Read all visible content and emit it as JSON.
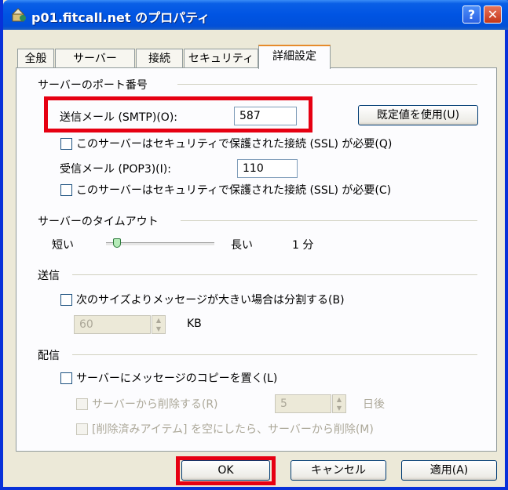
{
  "window": {
    "title": "p01.fitcall.net のプロパティ",
    "help_label": "?",
    "close_label": "✕"
  },
  "tabs": [
    {
      "label": "全般"
    },
    {
      "label": "サーバー"
    },
    {
      "label": "接続"
    },
    {
      "label": "セキュリティ"
    },
    {
      "label": "詳細設定"
    }
  ],
  "ports": {
    "section_title": "サーバーのポート番号",
    "smtp_label": "送信メール (SMTP)(O):",
    "smtp_value": "587",
    "default_button": "既定値を使用(U)",
    "smtp_ssl_label": "このサーバーはセキュリティで保護された接続 (SSL) が必要(Q)",
    "pop3_label": "受信メール (POP3)(I):",
    "pop3_value": "110",
    "pop3_ssl_label": "このサーバーはセキュリティで保護された接続 (SSL) が必要(C)"
  },
  "timeout": {
    "section_title": "サーバーのタイムアウト",
    "short_label": "短い",
    "long_label": "長い",
    "value_label": "1 分",
    "slider_level": 0.1
  },
  "sending": {
    "section_title": "送信",
    "split_label": "次のサイズよりメッセージが大きい場合は分割する(B)",
    "size_value": "60",
    "unit_label": "KB"
  },
  "delivery": {
    "section_title": "配信",
    "leave_copy_label": "サーバーにメッセージのコピーを置く(L)",
    "remove_label": "サーバーから削除する(R)",
    "days_value": "5",
    "days_unit": "日後",
    "remove_deleted_label": "[削除済みアイテム] を空にしたら、サーバーから削除(M)"
  },
  "buttons": {
    "ok": "OK",
    "cancel": "キャンセル",
    "apply": "適用(A)"
  },
  "colors": {
    "highlight": "#E60012",
    "titlebar": "#0054E3"
  }
}
